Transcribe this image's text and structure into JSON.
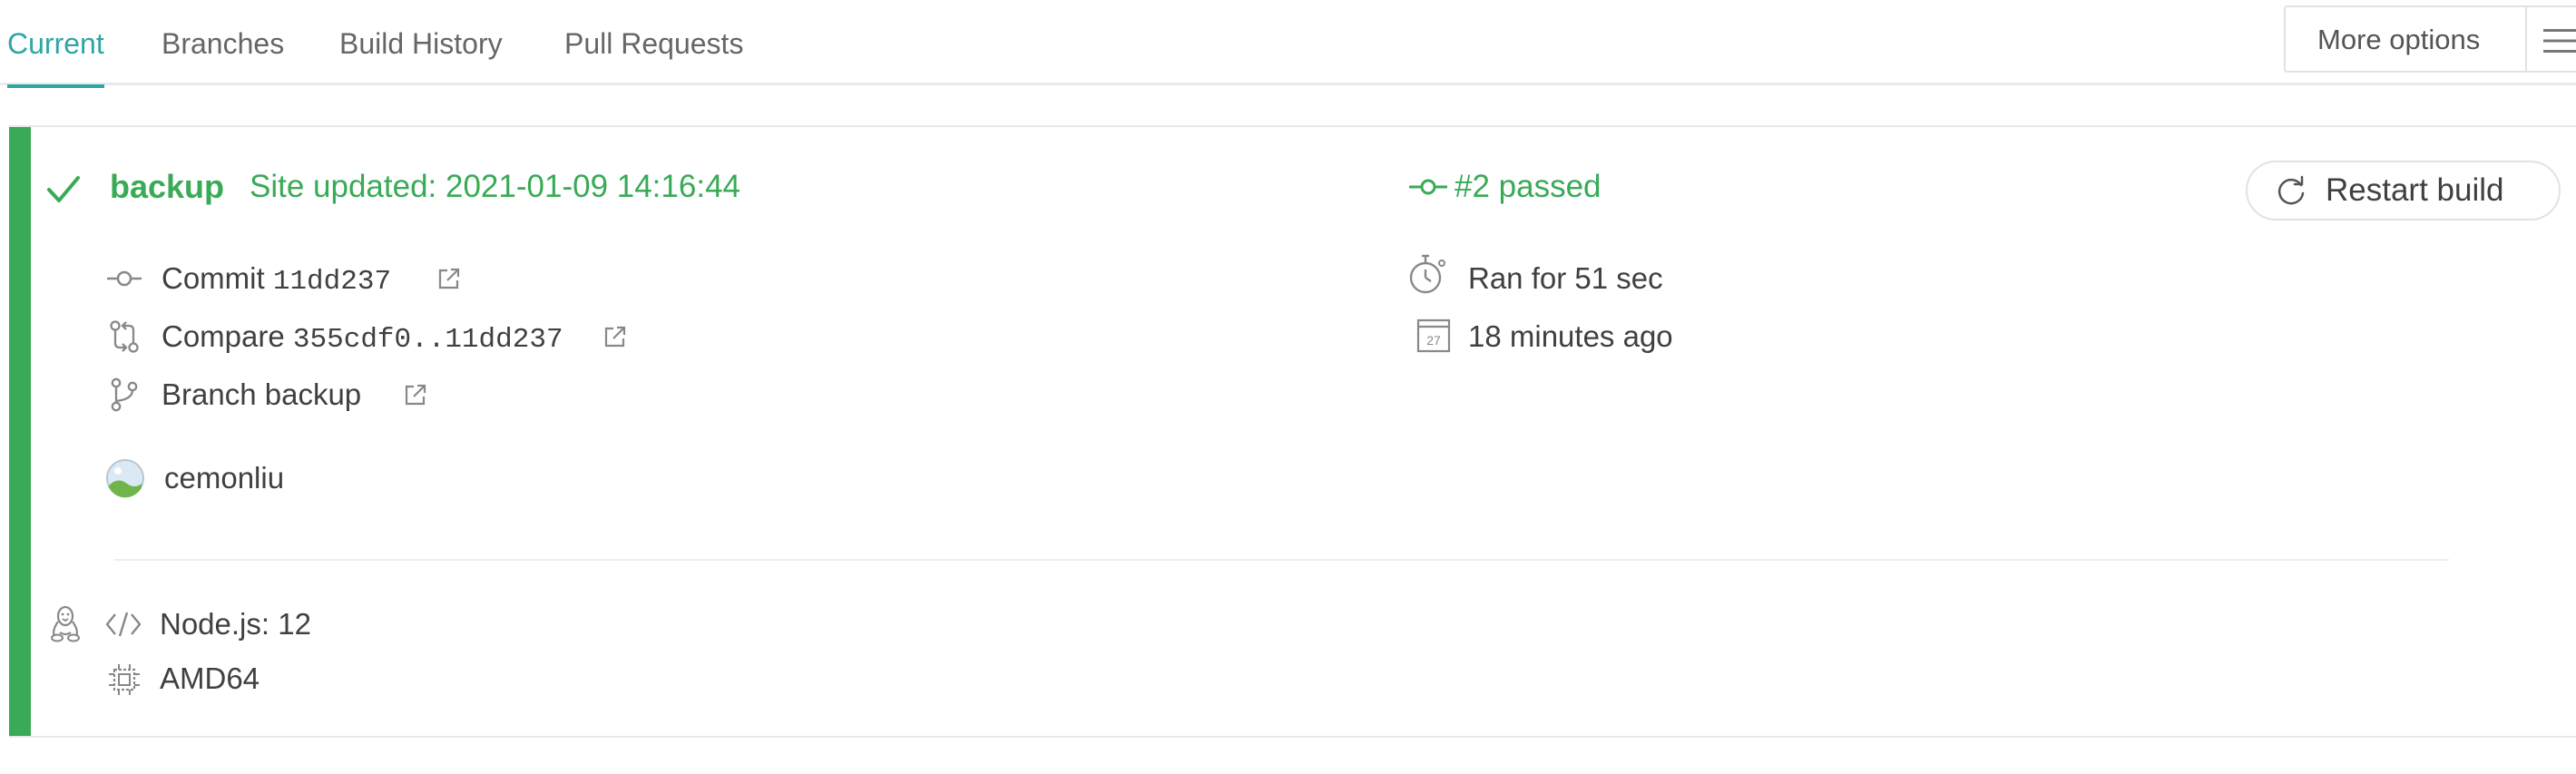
{
  "tabs": [
    {
      "label": "Current",
      "active": true
    },
    {
      "label": "Branches",
      "active": false
    },
    {
      "label": "Build History",
      "active": false
    },
    {
      "label": "Pull Requests",
      "active": false
    }
  ],
  "more_options": {
    "label": "More options",
    "icon": "hamburger-menu-icon"
  },
  "build": {
    "status_color": "#39aa56",
    "status_icon": "check-icon",
    "branch": "backup",
    "commit_message": "Site updated: 2021-01-09 14:16:44",
    "status_text": "#2 passed",
    "restart_label": "Restart build",
    "commit": {
      "label": "Commit",
      "value": "11dd237"
    },
    "compare": {
      "label": "Compare",
      "value": "355cdf0..11dd237"
    },
    "branch_row": {
      "label": "Branch",
      "value": "backup"
    },
    "author": "cemonliu",
    "duration": "Ran for 51 sec",
    "finished": "18 minutes ago",
    "calendar_day": "27",
    "language": "Node.js: 12",
    "arch": "AMD64",
    "os_icon": "linux-tux-icon"
  },
  "colors": {
    "accent": "#2fa6a4",
    "passed": "#39aa56",
    "text": "#404040",
    "muted": "#666666",
    "border": "#e2e2e2"
  }
}
